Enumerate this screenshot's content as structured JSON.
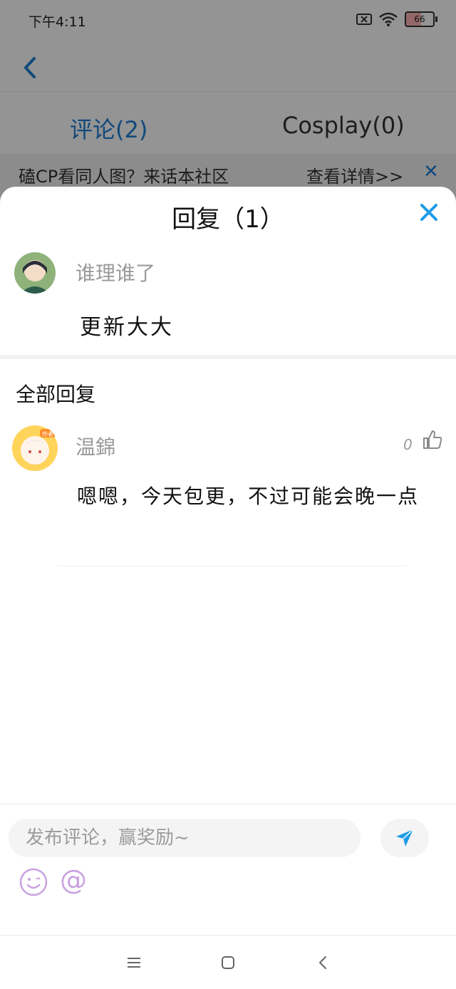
{
  "status_bar": {
    "time": "下午4:11",
    "battery": "66"
  },
  "tabs": [
    {
      "label": "评论(2)",
      "active": true
    },
    {
      "label": "Cosplay(0)",
      "active": false
    }
  ],
  "banner": {
    "text": "磕CP看同人图？来话本社区",
    "link": "查看详情>>"
  },
  "reply_sheet": {
    "title": "回复（1）",
    "original_comment": {
      "author": "谁理谁了",
      "content": "更新大大"
    },
    "all_replies_label": "全部回复",
    "replies": [
      {
        "author": "温錦",
        "badge": "作者",
        "likes": "0",
        "content": "嗯嗯，今天包更，不过可能会晚一点"
      }
    ]
  },
  "composer": {
    "placeholder": "发布评论，赢奖励~",
    "at_symbol": "@"
  },
  "colors": {
    "accent": "#1e7fd6",
    "muted_text": "#9a9a9a",
    "emoji_purple": "#c9a2e0"
  },
  "icons": [
    "back-arrow-icon",
    "close-icon",
    "like-icon",
    "send-icon",
    "emoji-icon",
    "menu-icon",
    "home-icon",
    "back-icon"
  ]
}
